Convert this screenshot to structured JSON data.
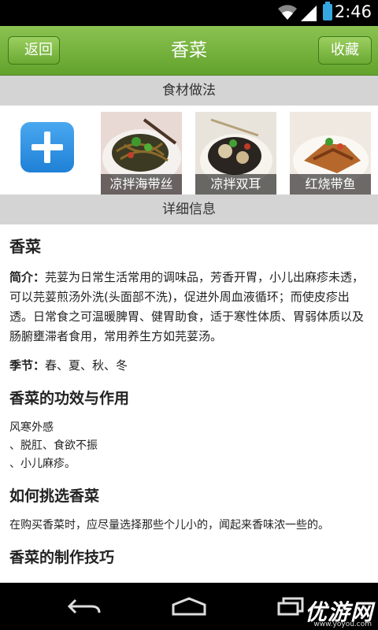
{
  "status_bar": {
    "time": "2:46"
  },
  "header": {
    "back_label": "返回",
    "title": "香菜",
    "favorite_label": "收藏"
  },
  "sections": {
    "methods": "食材做法",
    "details": "详细信息"
  },
  "recipes": [
    {
      "name": "凉拌海带丝"
    },
    {
      "name": "凉拌双耳"
    },
    {
      "name": "红烧带鱼"
    }
  ],
  "detail": {
    "name": "香菜",
    "intro_label": "简介：",
    "intro_text": "芫荽为日常生活常用的调味品，芳香开胃，小儿出麻疹未透，可以芫荽煎汤外洗(头面部不洗)，促进外周血液循环；而使皮疹出透。日常食之可温暖脾胃、健胃助食，适于寒性体质、胃弱体质以及肠腑壅滞者食用，常用养生方如芫荽汤。",
    "season_label": "季节：",
    "season_text": "春、夏、秋、冬",
    "effects_title": "香菜的功效与作用",
    "effects_lines": [
      "风寒外感",
      "、脱肛、食欲不振",
      "、小儿麻疹。"
    ],
    "select_title": "如何挑选香菜",
    "select_text": "在购买香菜时，应尽量选择那些个儿小的，闻起来香味浓一些的。",
    "tips_title": "香菜的制作技巧"
  },
  "watermark": {
    "text": "优游网",
    "sub": "www.yoyou.com"
  },
  "colors": {
    "header_green": "#6aa932",
    "section_gray": "#d4d4d4",
    "add_blue": "#2a8ee0"
  }
}
